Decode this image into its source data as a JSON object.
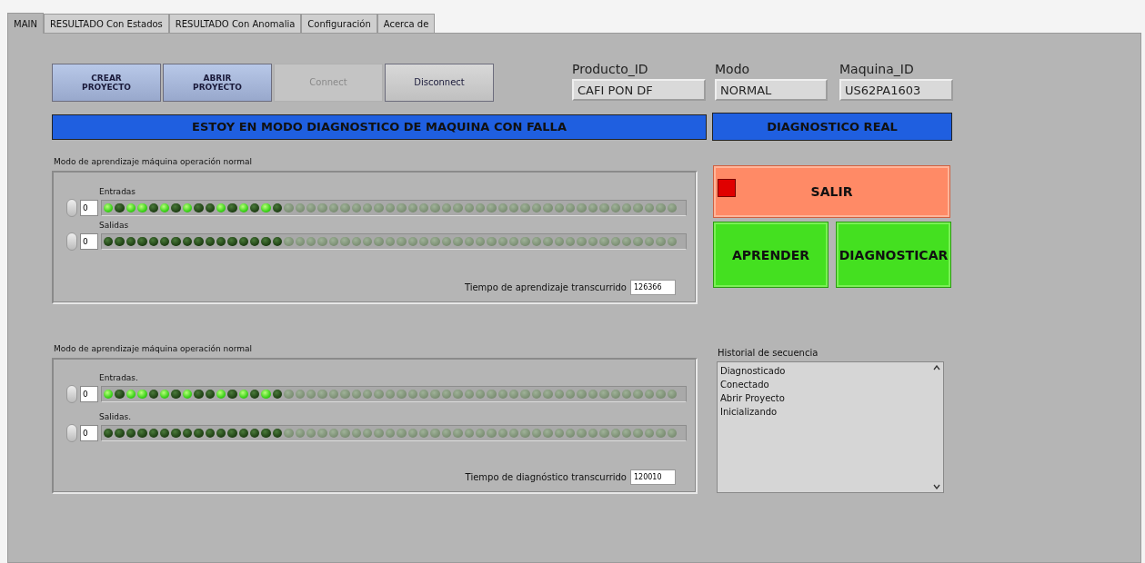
{
  "tabs": [
    {
      "label": "MAIN",
      "selected": true
    },
    {
      "label": "RESULTADO Con Estados",
      "selected": false
    },
    {
      "label": "RESULTADO Con Anomalia",
      "selected": false
    },
    {
      "label": "Configuración",
      "selected": false
    },
    {
      "label": "Acerca de",
      "selected": false
    }
  ],
  "buttons": [
    {
      "label": "CREAR PROYECTO",
      "kind": "primary",
      "disabled": false
    },
    {
      "label": "ABRIR PROYECTO",
      "kind": "primary",
      "disabled": false
    },
    {
      "label": "Connect",
      "kind": "plain",
      "disabled": true
    },
    {
      "label": "Disconnect",
      "kind": "plain",
      "disabled": false
    }
  ],
  "fields": [
    {
      "label": "Producto_ID",
      "value": "CAFI PON DF"
    },
    {
      "label": "Modo",
      "value": "NORMAL"
    },
    {
      "label": "Maquina_ID",
      "value": "US62PA1603"
    }
  ],
  "banner": "ESTOY EN MODO DIAGNOSTICO DE MAQUINA CON FALLA",
  "mode_banner": "DIAGNOSTICO REAL",
  "sections": [
    {
      "title": "Modo de aprendizaje máquina operación normal",
      "time_label": "Tiempo de aprendizaje transcurrido",
      "time_value": "126366",
      "arrays": [
        {
          "label": "Entradas",
          "index": "0",
          "leds": [
            {
              "on": true,
              "disabled": false
            },
            {
              "on": false,
              "disabled": false
            },
            {
              "on": true,
              "disabled": false
            },
            {
              "on": true,
              "disabled": false
            },
            {
              "on": false,
              "disabled": false
            },
            {
              "on": true,
              "disabled": false
            },
            {
              "on": false,
              "disabled": false
            },
            {
              "on": true,
              "disabled": false
            },
            {
              "on": false,
              "disabled": false
            },
            {
              "on": false,
              "disabled": false
            },
            {
              "on": true,
              "disabled": false
            },
            {
              "on": false,
              "disabled": false
            },
            {
              "on": true,
              "disabled": false
            },
            {
              "on": false,
              "disabled": false
            },
            {
              "on": true,
              "disabled": false
            },
            {
              "on": false,
              "disabled": false
            },
            {
              "on": false,
              "disabled": true
            },
            {
              "on": false,
              "disabled": true
            },
            {
              "on": false,
              "disabled": true
            },
            {
              "on": false,
              "disabled": true
            },
            {
              "on": false,
              "disabled": true
            },
            {
              "on": false,
              "disabled": true
            },
            {
              "on": false,
              "disabled": true
            },
            {
              "on": false,
              "disabled": true
            },
            {
              "on": false,
              "disabled": true
            },
            {
              "on": false,
              "disabled": true
            },
            {
              "on": false,
              "disabled": true
            },
            {
              "on": false,
              "disabled": true
            },
            {
              "on": false,
              "disabled": true
            },
            {
              "on": false,
              "disabled": true
            },
            {
              "on": false,
              "disabled": true
            },
            {
              "on": false,
              "disabled": true
            },
            {
              "on": false,
              "disabled": true
            },
            {
              "on": false,
              "disabled": true
            },
            {
              "on": false,
              "disabled": true
            },
            {
              "on": false,
              "disabled": true
            },
            {
              "on": false,
              "disabled": true
            },
            {
              "on": false,
              "disabled": true
            },
            {
              "on": false,
              "disabled": true
            },
            {
              "on": false,
              "disabled": true
            },
            {
              "on": false,
              "disabled": true
            },
            {
              "on": false,
              "disabled": true
            },
            {
              "on": false,
              "disabled": true
            },
            {
              "on": false,
              "disabled": true
            },
            {
              "on": false,
              "disabled": true
            },
            {
              "on": false,
              "disabled": true
            },
            {
              "on": false,
              "disabled": true
            },
            {
              "on": false,
              "disabled": true
            },
            {
              "on": false,
              "disabled": true
            },
            {
              "on": false,
              "disabled": true
            },
            {
              "on": false,
              "disabled": true
            }
          ]
        },
        {
          "label": "Salidas",
          "index": "0",
          "leds": [
            {
              "on": false,
              "disabled": false
            },
            {
              "on": false,
              "disabled": false
            },
            {
              "on": false,
              "disabled": false
            },
            {
              "on": false,
              "disabled": false
            },
            {
              "on": false,
              "disabled": false
            },
            {
              "on": false,
              "disabled": false
            },
            {
              "on": false,
              "disabled": false
            },
            {
              "on": false,
              "disabled": false
            },
            {
              "on": false,
              "disabled": false
            },
            {
              "on": false,
              "disabled": false
            },
            {
              "on": false,
              "disabled": false
            },
            {
              "on": false,
              "disabled": false
            },
            {
              "on": false,
              "disabled": false
            },
            {
              "on": false,
              "disabled": false
            },
            {
              "on": false,
              "disabled": false
            },
            {
              "on": false,
              "disabled": false
            },
            {
              "on": false,
              "disabled": true
            },
            {
              "on": false,
              "disabled": true
            },
            {
              "on": false,
              "disabled": true
            },
            {
              "on": false,
              "disabled": true
            },
            {
              "on": false,
              "disabled": true
            },
            {
              "on": false,
              "disabled": true
            },
            {
              "on": false,
              "disabled": true
            },
            {
              "on": false,
              "disabled": true
            },
            {
              "on": false,
              "disabled": true
            },
            {
              "on": false,
              "disabled": true
            },
            {
              "on": false,
              "disabled": true
            },
            {
              "on": false,
              "disabled": true
            },
            {
              "on": false,
              "disabled": true
            },
            {
              "on": false,
              "disabled": true
            },
            {
              "on": false,
              "disabled": true
            },
            {
              "on": false,
              "disabled": true
            },
            {
              "on": false,
              "disabled": true
            },
            {
              "on": false,
              "disabled": true
            },
            {
              "on": false,
              "disabled": true
            },
            {
              "on": false,
              "disabled": true
            },
            {
              "on": false,
              "disabled": true
            },
            {
              "on": false,
              "disabled": true
            },
            {
              "on": false,
              "disabled": true
            },
            {
              "on": false,
              "disabled": true
            },
            {
              "on": false,
              "disabled": true
            },
            {
              "on": false,
              "disabled": true
            },
            {
              "on": false,
              "disabled": true
            },
            {
              "on": false,
              "disabled": true
            },
            {
              "on": false,
              "disabled": true
            },
            {
              "on": false,
              "disabled": true
            },
            {
              "on": false,
              "disabled": true
            },
            {
              "on": false,
              "disabled": true
            },
            {
              "on": false,
              "disabled": true
            },
            {
              "on": false,
              "disabled": true
            },
            {
              "on": false,
              "disabled": true
            }
          ]
        }
      ]
    },
    {
      "title": "Modo de aprendizaje máquina operación normal",
      "time_label": "Tiempo de diagnóstico transcurrido",
      "time_value": "120010",
      "arrays": [
        {
          "label": "Entradas.",
          "index": "0",
          "leds": [
            {
              "on": true,
              "disabled": false
            },
            {
              "on": false,
              "disabled": false
            },
            {
              "on": true,
              "disabled": false
            },
            {
              "on": true,
              "disabled": false
            },
            {
              "on": false,
              "disabled": false
            },
            {
              "on": true,
              "disabled": false
            },
            {
              "on": false,
              "disabled": false
            },
            {
              "on": true,
              "disabled": false
            },
            {
              "on": false,
              "disabled": false
            },
            {
              "on": false,
              "disabled": false
            },
            {
              "on": true,
              "disabled": false
            },
            {
              "on": false,
              "disabled": false
            },
            {
              "on": true,
              "disabled": false
            },
            {
              "on": false,
              "disabled": false
            },
            {
              "on": true,
              "disabled": false
            },
            {
              "on": false,
              "disabled": false
            },
            {
              "on": false,
              "disabled": true
            },
            {
              "on": false,
              "disabled": true
            },
            {
              "on": false,
              "disabled": true
            },
            {
              "on": false,
              "disabled": true
            },
            {
              "on": false,
              "disabled": true
            },
            {
              "on": false,
              "disabled": true
            },
            {
              "on": false,
              "disabled": true
            },
            {
              "on": false,
              "disabled": true
            },
            {
              "on": false,
              "disabled": true
            },
            {
              "on": false,
              "disabled": true
            },
            {
              "on": false,
              "disabled": true
            },
            {
              "on": false,
              "disabled": true
            },
            {
              "on": false,
              "disabled": true
            },
            {
              "on": false,
              "disabled": true
            },
            {
              "on": false,
              "disabled": true
            },
            {
              "on": false,
              "disabled": true
            },
            {
              "on": false,
              "disabled": true
            },
            {
              "on": false,
              "disabled": true
            },
            {
              "on": false,
              "disabled": true
            },
            {
              "on": false,
              "disabled": true
            },
            {
              "on": false,
              "disabled": true
            },
            {
              "on": false,
              "disabled": true
            },
            {
              "on": false,
              "disabled": true
            },
            {
              "on": false,
              "disabled": true
            },
            {
              "on": false,
              "disabled": true
            },
            {
              "on": false,
              "disabled": true
            },
            {
              "on": false,
              "disabled": true
            },
            {
              "on": false,
              "disabled": true
            },
            {
              "on": false,
              "disabled": true
            },
            {
              "on": false,
              "disabled": true
            },
            {
              "on": false,
              "disabled": true
            },
            {
              "on": false,
              "disabled": true
            },
            {
              "on": false,
              "disabled": true
            },
            {
              "on": false,
              "disabled": true
            },
            {
              "on": false,
              "disabled": true
            }
          ]
        },
        {
          "label": "Salidas.",
          "index": "0",
          "leds": [
            {
              "on": false,
              "disabled": false
            },
            {
              "on": false,
              "disabled": false
            },
            {
              "on": false,
              "disabled": false
            },
            {
              "on": false,
              "disabled": false
            },
            {
              "on": false,
              "disabled": false
            },
            {
              "on": false,
              "disabled": false
            },
            {
              "on": false,
              "disabled": false
            },
            {
              "on": false,
              "disabled": false
            },
            {
              "on": false,
              "disabled": false
            },
            {
              "on": false,
              "disabled": false
            },
            {
              "on": false,
              "disabled": false
            },
            {
              "on": false,
              "disabled": false
            },
            {
              "on": false,
              "disabled": false
            },
            {
              "on": false,
              "disabled": false
            },
            {
              "on": false,
              "disabled": false
            },
            {
              "on": false,
              "disabled": false
            },
            {
              "on": false,
              "disabled": true
            },
            {
              "on": false,
              "disabled": true
            },
            {
              "on": false,
              "disabled": true
            },
            {
              "on": false,
              "disabled": true
            },
            {
              "on": false,
              "disabled": true
            },
            {
              "on": false,
              "disabled": true
            },
            {
              "on": false,
              "disabled": true
            },
            {
              "on": false,
              "disabled": true
            },
            {
              "on": false,
              "disabled": true
            },
            {
              "on": false,
              "disabled": true
            },
            {
              "on": false,
              "disabled": true
            },
            {
              "on": false,
              "disabled": true
            },
            {
              "on": false,
              "disabled": true
            },
            {
              "on": false,
              "disabled": true
            },
            {
              "on": false,
              "disabled": true
            },
            {
              "on": false,
              "disabled": true
            },
            {
              "on": false,
              "disabled": true
            },
            {
              "on": false,
              "disabled": true
            },
            {
              "on": false,
              "disabled": true
            },
            {
              "on": false,
              "disabled": true
            },
            {
              "on": false,
              "disabled": true
            },
            {
              "on": false,
              "disabled": true
            },
            {
              "on": false,
              "disabled": true
            },
            {
              "on": false,
              "disabled": true
            },
            {
              "on": false,
              "disabled": true
            },
            {
              "on": false,
              "disabled": true
            },
            {
              "on": false,
              "disabled": true
            },
            {
              "on": false,
              "disabled": true
            },
            {
              "on": false,
              "disabled": true
            },
            {
              "on": false,
              "disabled": true
            },
            {
              "on": false,
              "disabled": true
            },
            {
              "on": false,
              "disabled": true
            },
            {
              "on": false,
              "disabled": true
            },
            {
              "on": false,
              "disabled": true
            },
            {
              "on": false,
              "disabled": true
            }
          ]
        }
      ]
    }
  ],
  "exit_button": {
    "label": "SALIR",
    "lamp_on": true
  },
  "action_buttons": [
    "APRENDER",
    "DIAGNOSTICAR"
  ],
  "history": {
    "label": "Historial de secuencia",
    "items": [
      "Diagnosticado",
      "Conectado",
      "Abrir Proyecto",
      "Inicializando"
    ]
  }
}
